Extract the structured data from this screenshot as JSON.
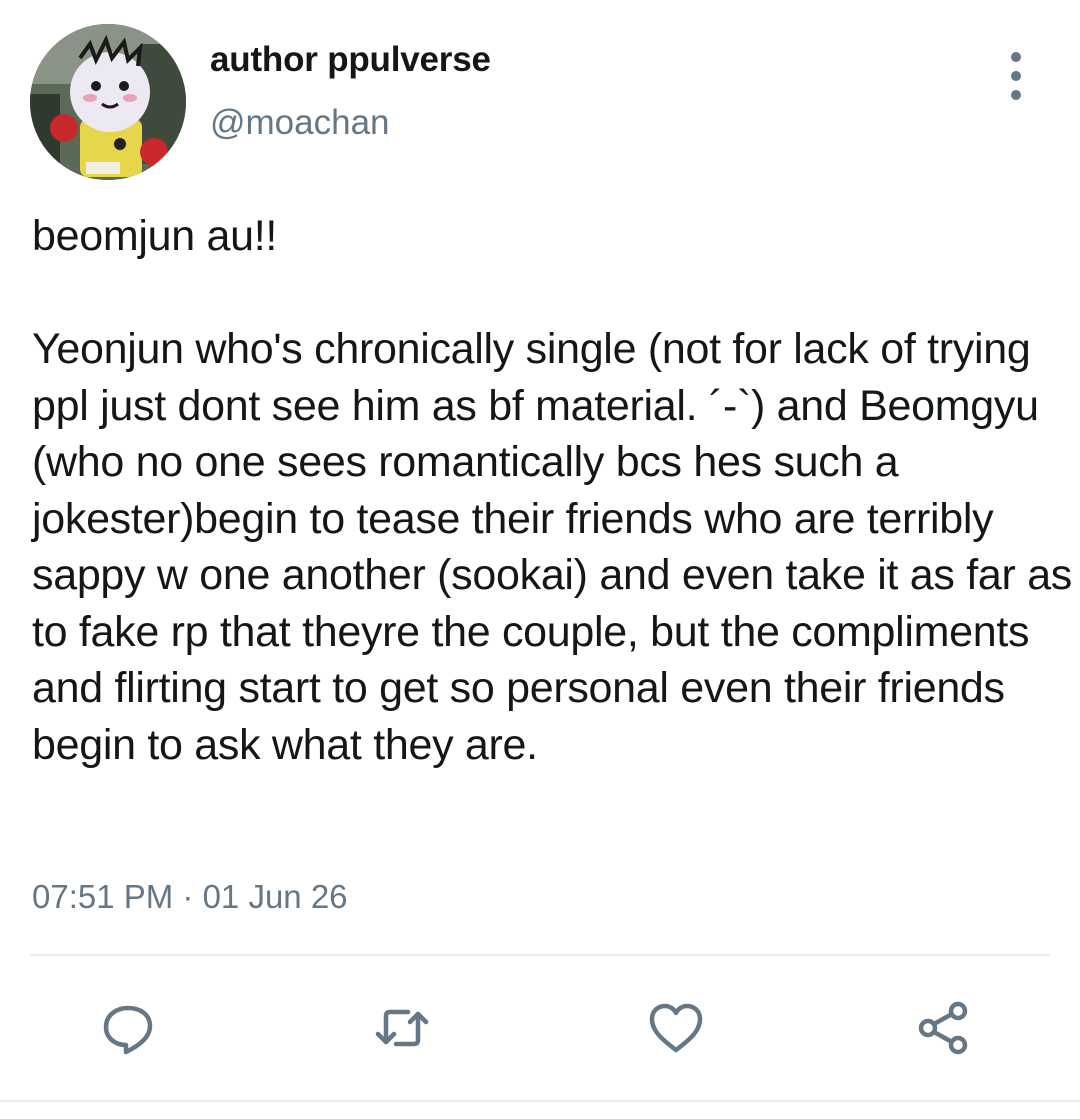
{
  "author": {
    "display_name": "author ppulverse",
    "handle": "@moachan",
    "avatar_icon": "plush-doll-avatar"
  },
  "tweet": {
    "text": "beomjun au!!\n\nYeonjun who's chronically single (not for lack of trying ppl just dont see him as bf material. ´-`) and Beomgyu (who no one sees romantically bcs hes such a jokester)begin to tease their friends who are terribly sappy w one another (sookai) and even take it as far as to fake rp that theyre the couple, but the compliments and flirting start to get so personal even their friends begin to ask what they are.",
    "timestamp": "07:51 PM · 01 Jun 26"
  },
  "actions": {
    "reply_icon": "reply-icon",
    "retweet_icon": "retweet-icon",
    "like_icon": "heart-icon",
    "share_icon": "share-icon"
  },
  "colors": {
    "text": "#14171a",
    "secondary": "#657786",
    "divider": "#e6ecf0"
  }
}
